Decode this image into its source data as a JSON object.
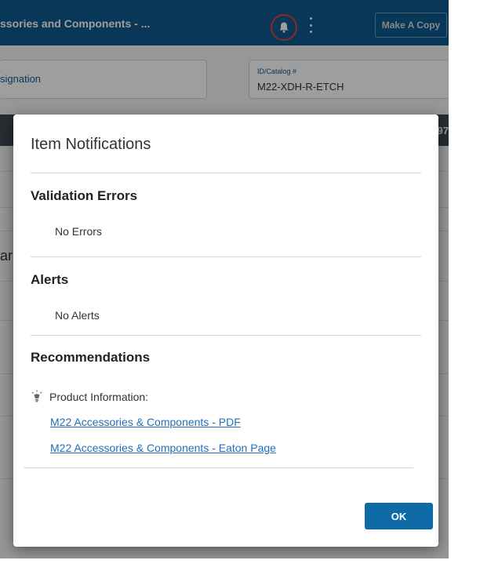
{
  "header": {
    "title": "ssories and Components - ...",
    "make_copy_label": "Make A Copy",
    "icons": [
      "bell-icon",
      "kebab-menu-icon"
    ]
  },
  "form": {
    "designation_text": "signation",
    "catalog_label": "ID/Catalog #",
    "catalog_value": "M22-XDH-R-ETCH"
  },
  "background": {
    "darkbar_fragment": "97",
    "side_fragment": "ar"
  },
  "modal": {
    "title": "Item Notifications",
    "validation": {
      "heading": "Validation Errors",
      "text": "No Errors"
    },
    "alerts": {
      "heading": "Alerts",
      "text": "No Alerts"
    },
    "recommendations": {
      "heading": "Recommendations",
      "icon": "lightbulb-icon",
      "label": "Product Information:",
      "links": [
        "M22 Accessories & Components - PDF",
        "M22 Accessories & Components - Eaton Page"
      ]
    },
    "ok_label": "OK",
    "colors": {
      "accent": "#0f6aa8",
      "link": "#1f6fb8",
      "header": "#0f5a8f",
      "highlight_ring": "#e0443a"
    }
  }
}
